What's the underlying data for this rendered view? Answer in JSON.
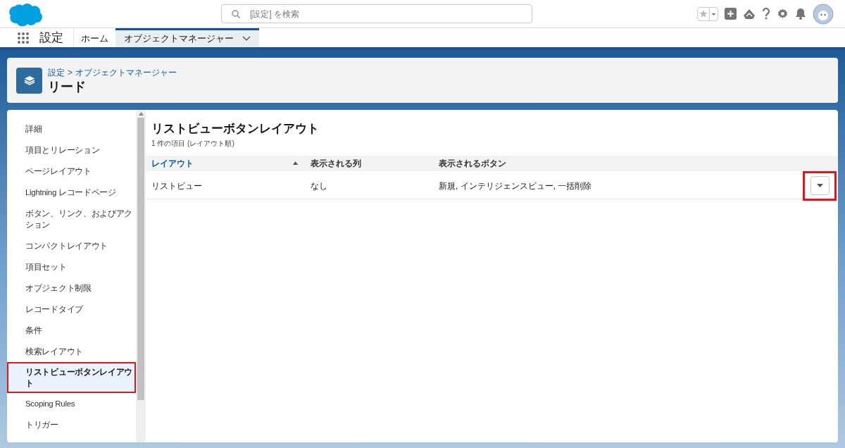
{
  "search": {
    "placeholder": "[設定] を検索"
  },
  "app": {
    "name": "設定"
  },
  "tabs": [
    {
      "label": "ホーム",
      "selected": false,
      "menu": false
    },
    {
      "label": "オブジェクトマネージャー",
      "selected": true,
      "menu": true
    }
  ],
  "breadcrumb": {
    "root": "設定",
    "separator": ">",
    "current": "オブジェクトマネージャー"
  },
  "object_title": "リード",
  "sidebar": {
    "items": [
      {
        "label": "詳細",
        "selected": false
      },
      {
        "label": "項目とリレーション",
        "selected": false
      },
      {
        "label": "ページレイアウト",
        "selected": false
      },
      {
        "label": "Lightning レコードページ",
        "selected": false
      },
      {
        "label": "ボタン、リンク、およびアクション",
        "selected": false
      },
      {
        "label": "コンパクトレイアウト",
        "selected": false
      },
      {
        "label": "項目セット",
        "selected": false
      },
      {
        "label": "オブジェクト制限",
        "selected": false
      },
      {
        "label": "レコードタイプ",
        "selected": false
      },
      {
        "label": "条件",
        "selected": false
      },
      {
        "label": "検索レイアウト",
        "selected": false
      },
      {
        "label": "リストビューボタンレイアウト",
        "selected": true
      },
      {
        "label": "Scoping Rules",
        "selected": false
      },
      {
        "label": "トリガー",
        "selected": false
      }
    ]
  },
  "section": {
    "title": "リストビューボタンレイアウト",
    "subtitle": "1 件の項目 (レイアウト順)"
  },
  "table": {
    "columns": [
      {
        "label": "レイアウト",
        "sorted": true
      },
      {
        "label": "表示される列",
        "sorted": false
      },
      {
        "label": "表示されるボタン",
        "sorted": false
      }
    ],
    "rows": [
      {
        "cells": [
          "リストビュー",
          "なし",
          "新規, インテリジェンスビュー, 一括削除"
        ],
        "highlighted": true
      }
    ]
  }
}
